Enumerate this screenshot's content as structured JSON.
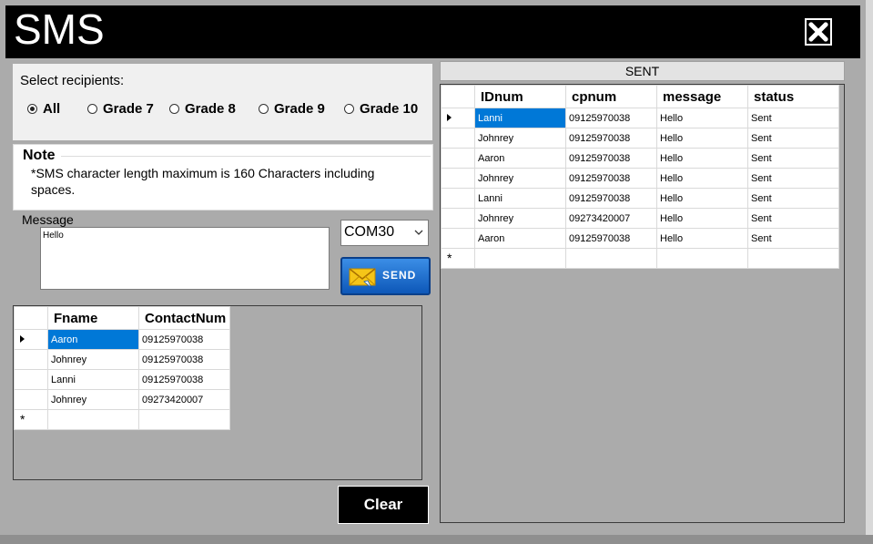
{
  "window": {
    "title": "SMS",
    "close_icon": "close-icon"
  },
  "recipients": {
    "label": "Select recipients:",
    "options": [
      {
        "label": "All",
        "selected": true
      },
      {
        "label": "Grade 7",
        "selected": false
      },
      {
        "label": "Grade 8",
        "selected": false
      },
      {
        "label": "Grade 9",
        "selected": false
      },
      {
        "label": "Grade 10",
        "selected": false
      }
    ]
  },
  "note": {
    "title": "Note",
    "text": "*SMS character length maximum is 160 Characters including spaces."
  },
  "message": {
    "label": "Message",
    "value": "Hello"
  },
  "port_select": {
    "value": "COM30"
  },
  "send_button": {
    "label": "SEND",
    "icon": "envelope-icon",
    "color": "#1565c0"
  },
  "contacts": {
    "columns": [
      "Fname",
      "ContactNum"
    ],
    "rows": [
      {
        "fname": "Aaron",
        "contact": "09125970038",
        "selected": true
      },
      {
        "fname": "Johnrey",
        "contact": "09125970038",
        "selected": false
      },
      {
        "fname": "Lanni",
        "contact": "09125970038",
        "selected": false
      },
      {
        "fname": "Johnrey",
        "contact": "09273420007",
        "selected": false
      }
    ],
    "new_row_marker": "*"
  },
  "sent": {
    "header": "SENT",
    "columns": [
      "IDnum",
      "cpnum",
      "message",
      "status"
    ],
    "rows": [
      {
        "idnum": "Lanni",
        "cpnum": "09125970038",
        "message": "Hello",
        "status": "Sent",
        "selected": true
      },
      {
        "idnum": "Johnrey",
        "cpnum": "09125970038",
        "message": "Hello",
        "status": "Sent",
        "selected": false
      },
      {
        "idnum": "Aaron",
        "cpnum": "09125970038",
        "message": "Hello",
        "status": "Sent",
        "selected": false
      },
      {
        "idnum": "Johnrey",
        "cpnum": "09125970038",
        "message": "Hello",
        "status": "Sent",
        "selected": false
      },
      {
        "idnum": "Lanni",
        "cpnum": "09125970038",
        "message": "Hello",
        "status": "Sent",
        "selected": false
      },
      {
        "idnum": "Johnrey",
        "cpnum": "09273420007",
        "message": "Hello",
        "status": "Sent",
        "selected": false
      },
      {
        "idnum": "Aaron",
        "cpnum": "09125970038",
        "message": "Hello",
        "status": "Sent",
        "selected": false
      }
    ],
    "new_row_marker": "*"
  },
  "clear_button": {
    "label": "Clear"
  },
  "colors": {
    "selection": "#0078d7",
    "titlebar": "#000000",
    "form_bg": "#ababab"
  }
}
